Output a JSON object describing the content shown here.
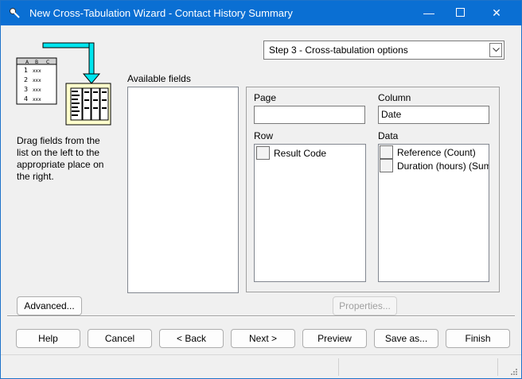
{
  "window": {
    "title": "New Cross-Tabulation Wizard - Contact History Summary",
    "controls": {
      "minimize": "—",
      "close": "✕"
    }
  },
  "graphic": {
    "sheet_headers": [
      "A",
      "B",
      "C"
    ],
    "sheet_rows": [
      "1",
      "2",
      "3",
      "4"
    ],
    "sheet_cell": "xxx"
  },
  "step_select": {
    "value": "Step 3 - Cross-tabulation options"
  },
  "help_text": "Drag fields from the list on the left to the appropriate place on the right.",
  "available_fields": {
    "label": "Available fields",
    "items": []
  },
  "page": {
    "label": "Page",
    "value": ""
  },
  "column": {
    "label": "Column",
    "value": "Date"
  },
  "row": {
    "label": "Row",
    "items": [
      "Result Code"
    ]
  },
  "data": {
    "label": "Data",
    "items": [
      "Reference (Count)",
      "Duration (hours) (Sum"
    ]
  },
  "buttons": {
    "advanced": "Advanced...",
    "properties": "Properties...",
    "help": "Help",
    "cancel": "Cancel",
    "back": "< Back",
    "next": "Next >",
    "preview": "Preview",
    "save_as": "Save as...",
    "finish": "Finish"
  },
  "colors": {
    "titlebar": "#0a6fd3",
    "graphic_arrow": "#00e5ee",
    "graphic_sheet": "#ffffcc"
  }
}
